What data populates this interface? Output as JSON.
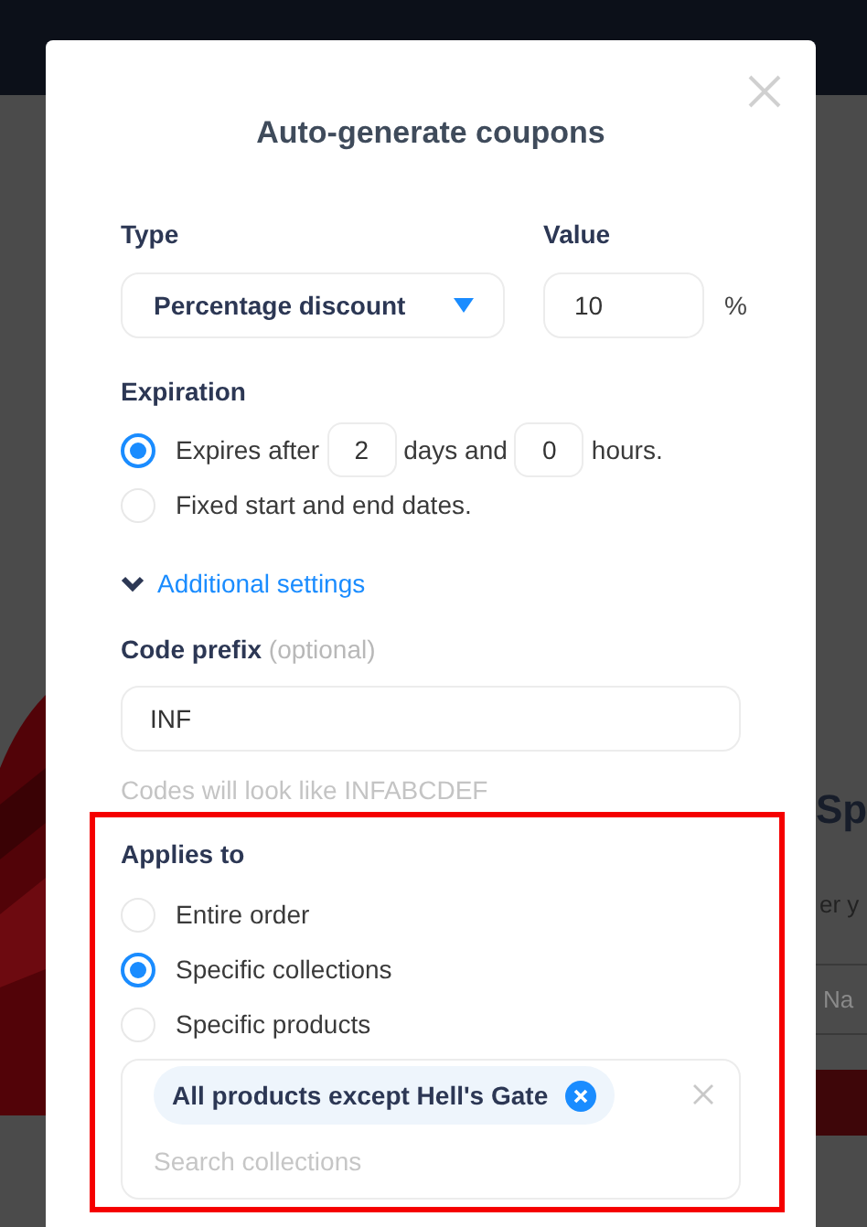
{
  "background": {
    "heading": "Sp",
    "subtitle": "er y",
    "tab": "Na"
  },
  "dialog": {
    "title": "Auto-generate coupons",
    "type": {
      "label": "Type",
      "value": "Percentage discount"
    },
    "value": {
      "label": "Value",
      "value": "10",
      "unit": "%"
    },
    "expiration": {
      "label": "Expiration",
      "options": [
        {
          "kind": "duration",
          "selected": true,
          "before": "Expires after",
          "days": "2",
          "middle": "days and",
          "hours": "0",
          "after": "hours."
        },
        {
          "kind": "plain",
          "selected": false,
          "label": "Fixed start and end dates."
        }
      ]
    },
    "additional_settings": {
      "label": "Additional settings",
      "expanded": true
    },
    "code_prefix": {
      "label": "Code prefix",
      "note": "(optional)",
      "value": "INF",
      "hint": "Codes will look like INFABCDEF"
    },
    "applies_to": {
      "highlighted": true,
      "label": "Applies to",
      "options": [
        {
          "kind": "plain",
          "selected": false,
          "label": "Entire order"
        },
        {
          "kind": "plain",
          "selected": true,
          "label": "Specific collections"
        },
        {
          "kind": "plain",
          "selected": false,
          "label": "Specific products"
        }
      ],
      "tags": [
        {
          "label": "All products except Hell's Gate"
        }
      ],
      "placeholder": "Search collections"
    }
  }
}
